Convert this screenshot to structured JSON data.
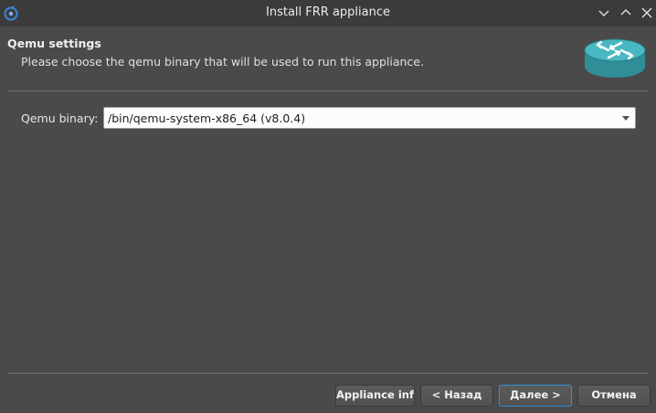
{
  "window": {
    "title": "Install FRR appliance"
  },
  "header": {
    "title": "Qemu settings",
    "subtitle": "Please choose the qemu binary that will be used to run this appliance."
  },
  "form": {
    "qemu_binary_label": "Qemu binary:",
    "qemu_binary_value": "/bin/qemu-system-x86_64 (v8.0.4)"
  },
  "buttons": {
    "appliance_info": "Appliance info",
    "back": "< Назад",
    "next": "Далее >",
    "cancel": "Отмена"
  },
  "colors": {
    "background": "#4a4a4a",
    "titlebar": "#3b3b3b",
    "focus_border": "#2f8fd8",
    "router_icon": "#3aa6b0"
  }
}
